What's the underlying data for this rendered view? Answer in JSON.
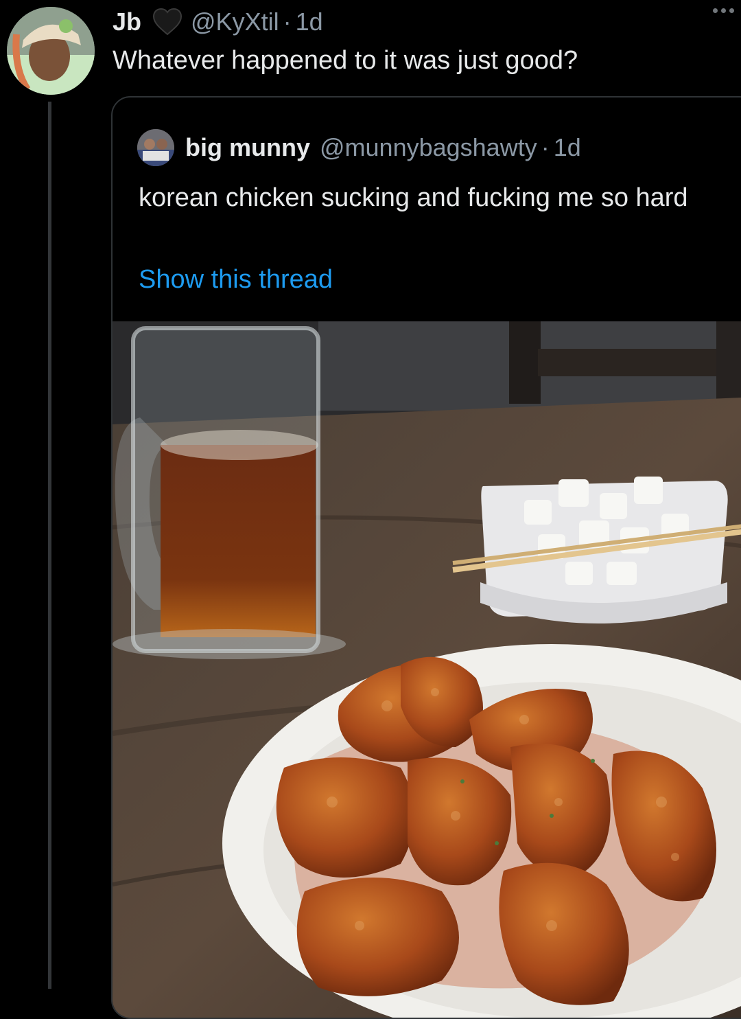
{
  "tweet": {
    "display_name": "Jb",
    "handle": "@KyXtil",
    "separator": "·",
    "time": "1d",
    "text": "Whatever happened to it was just good?",
    "avatar_icon": "profile-photo",
    "badge_icon": "black-heart-icon",
    "more_icon": "more-dots-icon"
  },
  "quote": {
    "display_name": "big munny",
    "handle": "@munnybagshawty",
    "separator": "·",
    "time": "1d",
    "text": "korean chicken sucking and fucking me so hard",
    "link": "Show this thread",
    "avatar_icon": "profile-photo",
    "photo_icon": "attached-photo"
  },
  "colors": {
    "background": "#000000",
    "text": "#e7e9ea",
    "muted": "#8b98a5",
    "link": "#1d9bf0",
    "border": "#2f3336"
  }
}
